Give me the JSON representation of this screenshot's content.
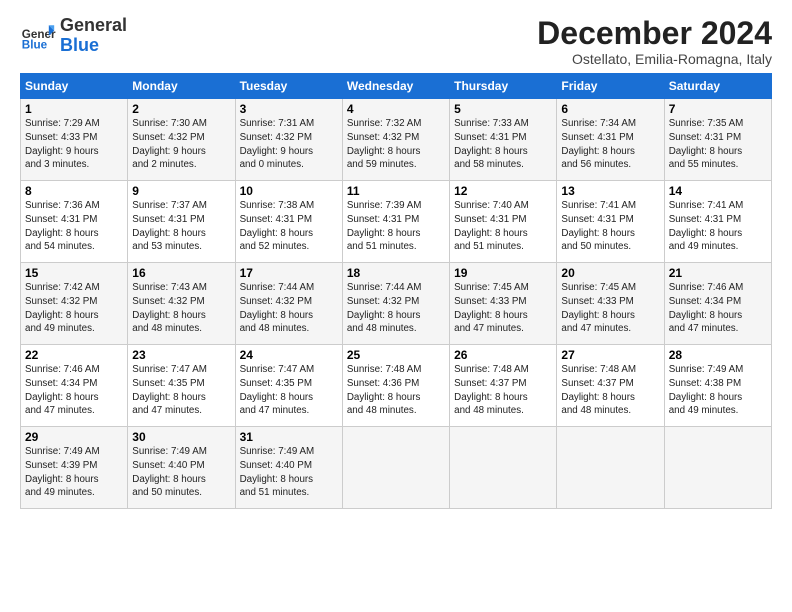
{
  "logo": {
    "general": "General",
    "blue": "Blue"
  },
  "title": "December 2024",
  "subtitle": "Ostellato, Emilia-Romagna, Italy",
  "days_header": [
    "Sunday",
    "Monday",
    "Tuesday",
    "Wednesday",
    "Thursday",
    "Friday",
    "Saturday"
  ],
  "weeks": [
    [
      {
        "day": "1",
        "info": "Sunrise: 7:29 AM\nSunset: 4:33 PM\nDaylight: 9 hours\nand 3 minutes."
      },
      {
        "day": "2",
        "info": "Sunrise: 7:30 AM\nSunset: 4:32 PM\nDaylight: 9 hours\nand 2 minutes."
      },
      {
        "day": "3",
        "info": "Sunrise: 7:31 AM\nSunset: 4:32 PM\nDaylight: 9 hours\nand 0 minutes."
      },
      {
        "day": "4",
        "info": "Sunrise: 7:32 AM\nSunset: 4:32 PM\nDaylight: 8 hours\nand 59 minutes."
      },
      {
        "day": "5",
        "info": "Sunrise: 7:33 AM\nSunset: 4:31 PM\nDaylight: 8 hours\nand 58 minutes."
      },
      {
        "day": "6",
        "info": "Sunrise: 7:34 AM\nSunset: 4:31 PM\nDaylight: 8 hours\nand 56 minutes."
      },
      {
        "day": "7",
        "info": "Sunrise: 7:35 AM\nSunset: 4:31 PM\nDaylight: 8 hours\nand 55 minutes."
      }
    ],
    [
      {
        "day": "8",
        "info": "Sunrise: 7:36 AM\nSunset: 4:31 PM\nDaylight: 8 hours\nand 54 minutes."
      },
      {
        "day": "9",
        "info": "Sunrise: 7:37 AM\nSunset: 4:31 PM\nDaylight: 8 hours\nand 53 minutes."
      },
      {
        "day": "10",
        "info": "Sunrise: 7:38 AM\nSunset: 4:31 PM\nDaylight: 8 hours\nand 52 minutes."
      },
      {
        "day": "11",
        "info": "Sunrise: 7:39 AM\nSunset: 4:31 PM\nDaylight: 8 hours\nand 51 minutes."
      },
      {
        "day": "12",
        "info": "Sunrise: 7:40 AM\nSunset: 4:31 PM\nDaylight: 8 hours\nand 51 minutes."
      },
      {
        "day": "13",
        "info": "Sunrise: 7:41 AM\nSunset: 4:31 PM\nDaylight: 8 hours\nand 50 minutes."
      },
      {
        "day": "14",
        "info": "Sunrise: 7:41 AM\nSunset: 4:31 PM\nDaylight: 8 hours\nand 49 minutes."
      }
    ],
    [
      {
        "day": "15",
        "info": "Sunrise: 7:42 AM\nSunset: 4:32 PM\nDaylight: 8 hours\nand 49 minutes."
      },
      {
        "day": "16",
        "info": "Sunrise: 7:43 AM\nSunset: 4:32 PM\nDaylight: 8 hours\nand 48 minutes."
      },
      {
        "day": "17",
        "info": "Sunrise: 7:44 AM\nSunset: 4:32 PM\nDaylight: 8 hours\nand 48 minutes."
      },
      {
        "day": "18",
        "info": "Sunrise: 7:44 AM\nSunset: 4:32 PM\nDaylight: 8 hours\nand 48 minutes."
      },
      {
        "day": "19",
        "info": "Sunrise: 7:45 AM\nSunset: 4:33 PM\nDaylight: 8 hours\nand 47 minutes."
      },
      {
        "day": "20",
        "info": "Sunrise: 7:45 AM\nSunset: 4:33 PM\nDaylight: 8 hours\nand 47 minutes."
      },
      {
        "day": "21",
        "info": "Sunrise: 7:46 AM\nSunset: 4:34 PM\nDaylight: 8 hours\nand 47 minutes."
      }
    ],
    [
      {
        "day": "22",
        "info": "Sunrise: 7:46 AM\nSunset: 4:34 PM\nDaylight: 8 hours\nand 47 minutes."
      },
      {
        "day": "23",
        "info": "Sunrise: 7:47 AM\nSunset: 4:35 PM\nDaylight: 8 hours\nand 47 minutes."
      },
      {
        "day": "24",
        "info": "Sunrise: 7:47 AM\nSunset: 4:35 PM\nDaylight: 8 hours\nand 47 minutes."
      },
      {
        "day": "25",
        "info": "Sunrise: 7:48 AM\nSunset: 4:36 PM\nDaylight: 8 hours\nand 48 minutes."
      },
      {
        "day": "26",
        "info": "Sunrise: 7:48 AM\nSunset: 4:37 PM\nDaylight: 8 hours\nand 48 minutes."
      },
      {
        "day": "27",
        "info": "Sunrise: 7:48 AM\nSunset: 4:37 PM\nDaylight: 8 hours\nand 48 minutes."
      },
      {
        "day": "28",
        "info": "Sunrise: 7:49 AM\nSunset: 4:38 PM\nDaylight: 8 hours\nand 49 minutes."
      }
    ],
    [
      {
        "day": "29",
        "info": "Sunrise: 7:49 AM\nSunset: 4:39 PM\nDaylight: 8 hours\nand 49 minutes."
      },
      {
        "day": "30",
        "info": "Sunrise: 7:49 AM\nSunset: 4:40 PM\nDaylight: 8 hours\nand 50 minutes."
      },
      {
        "day": "31",
        "info": "Sunrise: 7:49 AM\nSunset: 4:40 PM\nDaylight: 8 hours\nand 51 minutes."
      },
      null,
      null,
      null,
      null
    ]
  ]
}
